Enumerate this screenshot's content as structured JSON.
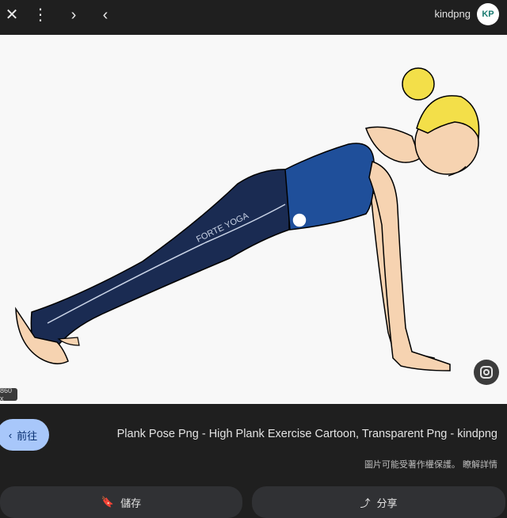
{
  "topbar": {
    "site_name": "kindpng",
    "logo_text": "KP",
    "icons": [
      "close-icon",
      "more-vert-icon",
      "chevron-right-icon",
      "chevron-left-icon"
    ]
  },
  "image": {
    "size_badge": "860 x",
    "pants_text": "FORTE YOGA"
  },
  "result": {
    "title": "Plank Pose Png - High Plank Exercise Cartoon, Transparent Png - kindpng",
    "copyright": "圖片可能受著作權保護。 瞭解詳情",
    "visit_label": "前往"
  },
  "bottom": {
    "save_label": "儲存",
    "share_label": "分享"
  },
  "colors": {
    "accent": "#a8c7fa",
    "shirt": "#1f4f9a",
    "pants": "#1a2b52",
    "hair": "#f3df49",
    "skin": "#f6d3b1"
  }
}
